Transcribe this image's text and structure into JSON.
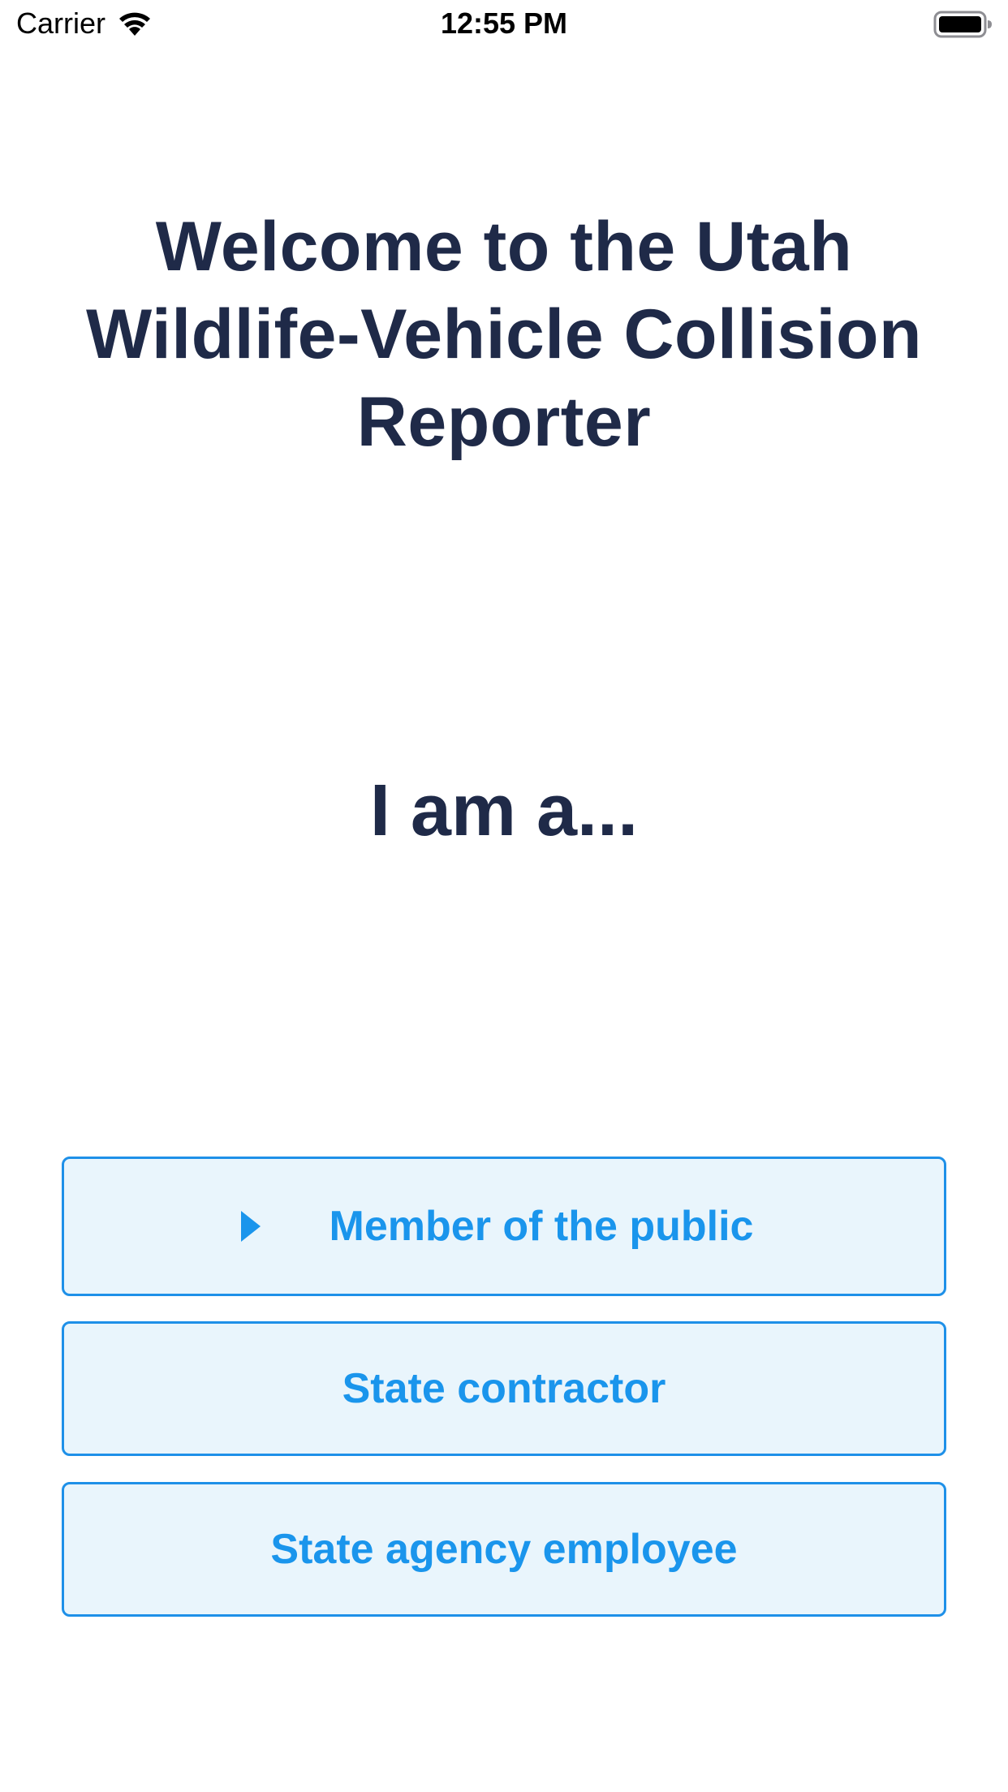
{
  "status_bar": {
    "carrier": "Carrier",
    "time": "12:55 PM",
    "icons": [
      "wifi-icon",
      "battery-icon"
    ]
  },
  "welcome": {
    "title_line1": "Welcome to the Utah",
    "title_line2": "Wildlife-Vehicle Collision",
    "title_line3": "Reporter"
  },
  "prompt": "I am a...",
  "roles": {
    "public": "Member of the public",
    "contractor": "State contractor",
    "employee": "State agency employee",
    "selected_icon": "caret-right-icon"
  },
  "colors": {
    "title_text": "#1f2a48",
    "button_text": "#1a95ec",
    "button_border": "#1e90e8",
    "button_background": "#e9f5fc"
  }
}
